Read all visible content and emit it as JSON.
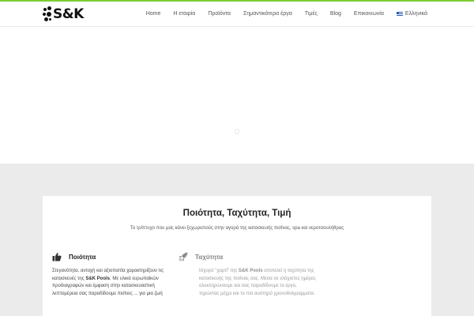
{
  "header": {
    "logo_text": "S&K",
    "nav": [
      {
        "label": "Home"
      },
      {
        "label": "Η εταιρία"
      },
      {
        "label": "Προϊόντα"
      },
      {
        "label": "Σημαντικότερα έργα"
      },
      {
        "label": "Τιμές"
      },
      {
        "label": "Blog"
      },
      {
        "label": "Επικοινωνία"
      },
      {
        "label": "Ελληνικά",
        "icon": "greek-flag-icon"
      }
    ]
  },
  "colors": {
    "accent_bar": "#7dcd33",
    "section_background": "#ebebeb"
  },
  "section": {
    "title": "Ποιότητα, Ταχύτητα, Τιμή",
    "subtitle": "Το τρίπτυχο που μας κάνει ξεχωριστούς στην αγορά της κατασκευής πισίνας, spa και νεροτσουλήθρας"
  },
  "features": [
    {
      "icon": "thumbs-up-icon",
      "title": "Ποιότητα",
      "text_before": "Στεγανότητα, αντοχή και αξιοπιστία χαρακτηρίζουν τις κατασκευές της ",
      "text_bold": "S&K Pools",
      "text_after": ". Με υλικά ευρωπαϊκών προδιαγραφών και έμφαση στην κατασκευαστική λεπτομέρεια σας παραδίδουμε πισίνες ... για μια ζωή"
    },
    {
      "icon": "rocket-icon",
      "title": "Ταχύτητα",
      "text_before": "Ισχυρό \"χαρτί\" της ",
      "text_bold": "S&K Pools",
      "text_after": " αποτελεί η ταχύτητα της κατασκευής της πισίνας σας. Μέσα σε ελάχιστες ημέρες ολοκληρώνουμε και σας παραδίδουμε το έργο, τηρώντας μέχρι και το πιο αυστηρό χρονοδιάγραμματα."
    }
  ]
}
